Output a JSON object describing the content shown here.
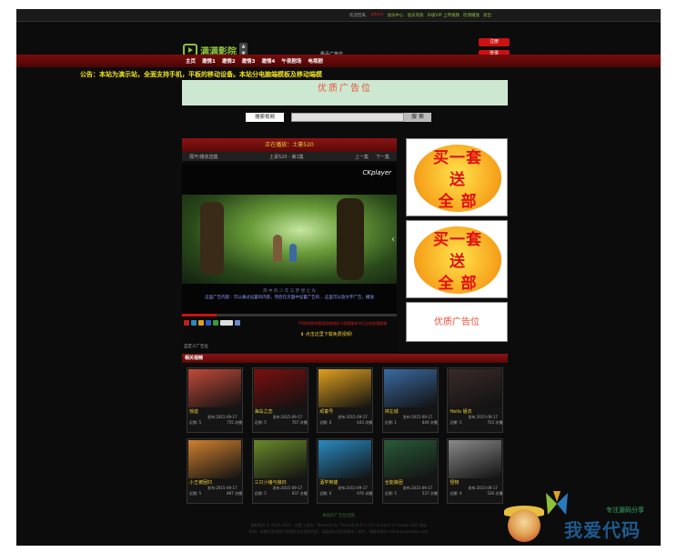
{
  "topbar": {
    "welcome": "欢迎回来,",
    "username": "admin",
    "links": [
      "会员中心",
      "会员充值",
      "升级VIP 上传视频",
      "检测播放",
      "退出"
    ]
  },
  "header": {
    "logo_text": "满满影院",
    "ad_label": "极品广告位",
    "register_label": "注册",
    "login_label": "登录"
  },
  "nav": {
    "items": [
      "主页",
      "邀情1",
      "邀情2",
      "邀情3",
      "邀情4",
      "午夜剧场",
      "电视剧"
    ]
  },
  "notice": "公告：本站为演示站，全面支持手机，平板的移动设备。本站分电脑端模板及移动端模",
  "banner_top": "优质广告位",
  "search": {
    "label": "搜索视频",
    "button": "搜 索"
  },
  "player": {
    "title": "正在播放：土豪520",
    "expand": "展开/播放选集",
    "episode": "土豪520 - 第1集",
    "prev": "上一集",
    "next": "下一集",
    "brand": "CKplayer",
    "caption1": "风 中 的 少 年  与 梦 想 之 光",
    "caption2": "这里广告内容：可以通过设置的内容，然后在页面中设置广告的...  这里可以放文字广告，播放",
    "progress": 0.16,
    "note": "FR网站您的使用及修改关于前面版本中已过长的画期调",
    "download": "点击这里下载免费视频!",
    "custom_ad": "自定义广告位"
  },
  "sidebar_ads": {
    "promo_lines": [
      "买一套",
      "送",
      "全 部"
    ],
    "ad_label": "优质广告位"
  },
  "related": {
    "heading": "相关视频",
    "items": [
      {
        "title": "惊迹",
        "date": "发布:2015-09-17",
        "rank": "近期: 5",
        "views": "755 次播",
        "color": "#c04a3a"
      },
      {
        "title": "海岛之恋",
        "date": "发布:2015-09-17",
        "rank": "近期: 5",
        "views": "767 次播",
        "color": "#7a1010"
      },
      {
        "title": "顽童号",
        "date": "发布:2015-09-17",
        "rank": "近期: 0",
        "views": "643 次播",
        "color": "#e0a020"
      },
      {
        "title": "林左城",
        "date": "发布:2015-09-17",
        "rank": "近期: 1",
        "views": "849 次播",
        "color": "#3a6aa0"
      },
      {
        "title": "Hello 姐衣",
        "date": "发布:2015-09-17",
        "rank": "近期: 5",
        "views": "703 次播",
        "color": "#3a2a2a"
      },
      {
        "title": "小王被困妇",
        "date": "发布:2015-09-17",
        "rank": "近期: 5",
        "views": "897 次播",
        "color": "#d08030"
      },
      {
        "title": "三只小猪与狼妇",
        "date": "发布:2015-09-17",
        "rank": "近期: 5",
        "views": "937 次播",
        "color": "#6a8a2a"
      },
      {
        "title": "酒学英雄",
        "date": "发布:2015-09-17",
        "rank": "近期: 0",
        "views": "976 次播",
        "color": "#2a8ac0"
      },
      {
        "title": "全能狼团",
        "date": "发布:2015-09-17",
        "rank": "近期: 5",
        "views": "537 次播",
        "color": "#2a5a3a"
      },
      {
        "title": "怪物",
        "date": "发布:2015-09-17",
        "rank": "近期: 4",
        "views": "526 次播",
        "color": "#8a8a8a"
      }
    ]
  },
  "footer": {
    "line1": "本站的广告位出售",
    "line2": "满影影院 © 2015-2019 · 内置 工具包 · Powered by ThemeSoft 6.1.1.0 | product | P reader SEO 模板",
    "line3": "声明：如果您发现我们的网页存在侵权内容，请速速与我们的联系人联系，请联系邮件 admin@example.com"
  },
  "watermark": {
    "small": "专注源码分享",
    "big": "我爱代码"
  }
}
